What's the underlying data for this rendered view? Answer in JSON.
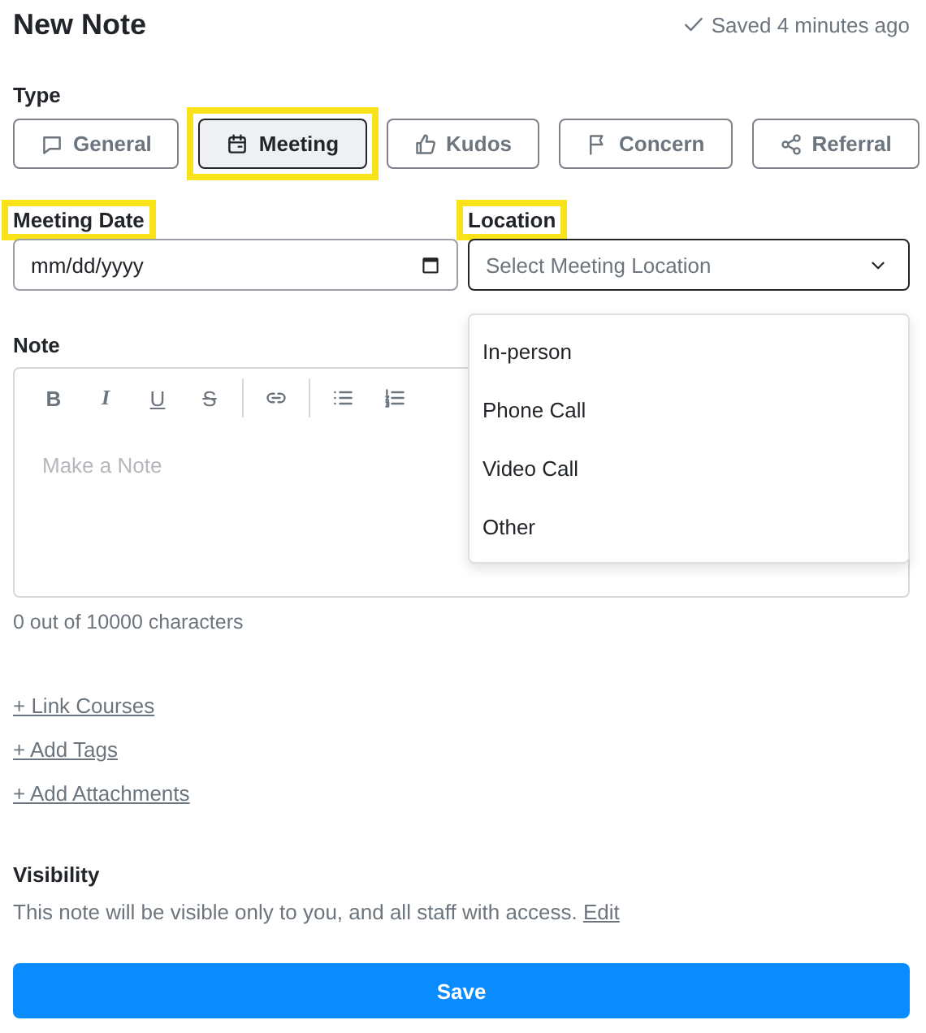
{
  "header": {
    "title": "New Note",
    "status": "Saved 4 minutes ago"
  },
  "type": {
    "label": "Type",
    "tabs": [
      {
        "label": "General",
        "kind": "chat",
        "selected": false,
        "highlighted": false
      },
      {
        "label": "Meeting",
        "kind": "calendar",
        "selected": true,
        "highlighted": true
      },
      {
        "label": "Kudos",
        "kind": "thumb",
        "selected": false,
        "highlighted": false
      },
      {
        "label": "Concern",
        "kind": "flag",
        "selected": false,
        "highlighted": false
      },
      {
        "label": "Referral",
        "kind": "share",
        "selected": false,
        "highlighted": false
      }
    ]
  },
  "meeting_date": {
    "label": "Meeting Date",
    "highlighted": true,
    "placeholder": "mm/dd/yyyy"
  },
  "location": {
    "label": "Location",
    "highlighted": true,
    "placeholder": "Select Meeting Location",
    "expanded": true,
    "options": [
      "In-person",
      "Phone Call",
      "Video Call",
      "Other"
    ]
  },
  "note": {
    "label": "Note",
    "toolbar": [
      {
        "kind": "bold",
        "label": "B"
      },
      {
        "kind": "italic",
        "label": "I"
      },
      {
        "kind": "underline",
        "label": "U"
      },
      {
        "kind": "strike",
        "label": "S"
      },
      {
        "kind": "separator"
      },
      {
        "kind": "link"
      },
      {
        "kind": "separator"
      },
      {
        "kind": "bullets"
      },
      {
        "kind": "numbers"
      }
    ],
    "placeholder": "Make a Note",
    "counter": "0 out of 10000 characters"
  },
  "links": [
    "+ Link Courses",
    "+ Add Tags",
    "+ Add Attachments"
  ],
  "visibility": {
    "label": "Visibility",
    "text": "This note will be visible only to you, and all staff with access.",
    "link": "Edit"
  },
  "save_button": "Save"
}
